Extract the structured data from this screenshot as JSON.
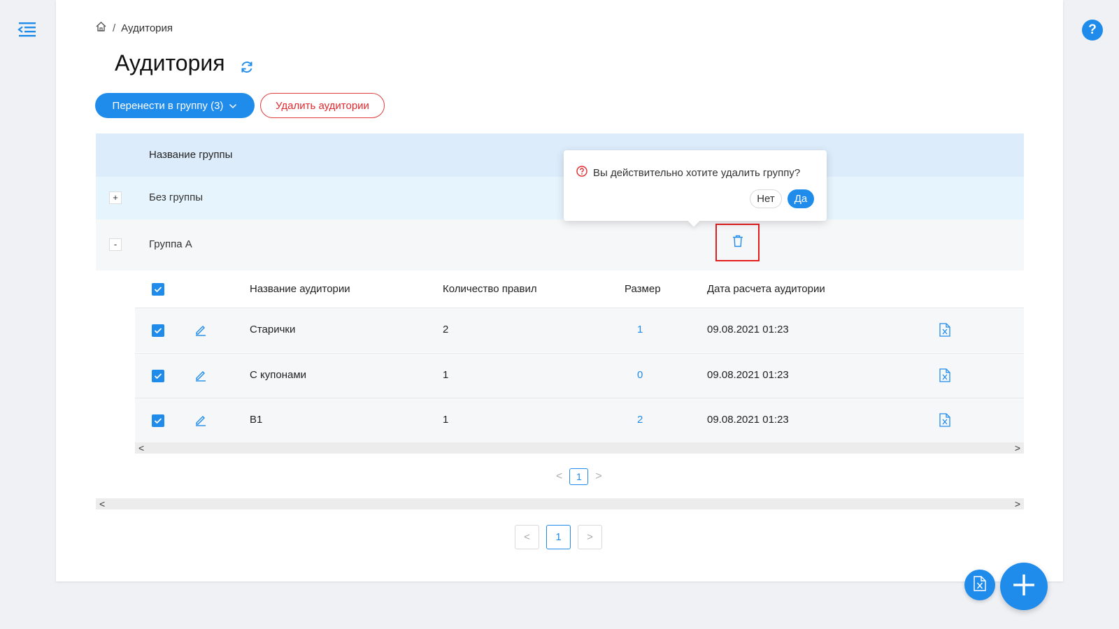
{
  "breadcrumb": {
    "home_icon": "home-icon",
    "separator": "/",
    "current": "Аудитория"
  },
  "page": {
    "title": "Аудитория",
    "refresh_icon": "refresh-icon"
  },
  "toolbar": {
    "move_label": "Перенести в группу (3)",
    "delete_label": "Удалить аудитории"
  },
  "groups_table": {
    "header": "Название группы",
    "rows": [
      {
        "expander": "+",
        "name": "Без группы"
      },
      {
        "expander": "-",
        "name": "Группа А"
      }
    ]
  },
  "popconfirm": {
    "message": "Вы действительно хотите удалить группу?",
    "no_label": "Нет",
    "yes_label": "Да"
  },
  "audience_table": {
    "headers": {
      "name": "Название аудитории",
      "rules": "Количество правил",
      "size": "Размер",
      "date": "Дата расчета аудитории"
    },
    "rows": [
      {
        "checked": true,
        "name": "Старички",
        "rules": "2",
        "size": "1",
        "date": "09.08.2021 01:23"
      },
      {
        "checked": true,
        "name": "С купонами",
        "rules": "1",
        "size": "0",
        "date": "09.08.2021 01:23"
      },
      {
        "checked": true,
        "name": "В1",
        "rules": "1",
        "size": "2",
        "date": "09.08.2021 01:23"
      }
    ]
  },
  "inner_pagination": {
    "prev": "<",
    "page": "1",
    "next": ">"
  },
  "outer_pagination": {
    "prev": "<",
    "page": "1",
    "next": ">"
  },
  "scrollbar": {
    "left": "<",
    "right": ">"
  },
  "help_label": "?",
  "colors": {
    "accent": "#1f8ceb",
    "danger": "#e0282e",
    "header_bg": "#dcecfb",
    "row_bg": "#e6f4fd"
  }
}
